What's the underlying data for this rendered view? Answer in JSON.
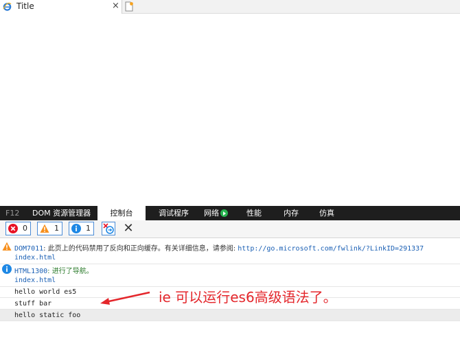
{
  "browser": {
    "tab_title": "Title",
    "close_glyph": "×"
  },
  "devtools": {
    "tabs": [
      {
        "label": "F12"
      },
      {
        "label": "DOM 资源管理器"
      },
      {
        "label": "控制台"
      },
      {
        "label": "调试程序"
      },
      {
        "label": "网络"
      },
      {
        "label": "性能"
      },
      {
        "label": "内存"
      },
      {
        "label": "仿真"
      }
    ],
    "active_tab": "控制台",
    "filters": {
      "errors": "0",
      "warnings": "1",
      "messages": "1"
    },
    "clear_glyph": "✕"
  },
  "console": {
    "warning": {
      "code": "DOM7011",
      "text": ": 此页上的代码禁用了反向和正向缓存。有关详细信息，请参阅: ",
      "url": "http://go.microsoft.com/fwlink/?LinkID=291337",
      "source": "index.html"
    },
    "info": {
      "code": "HTML1300",
      "text": ": 进行了导航。",
      "source": "index.html"
    },
    "logs": [
      "hello world es5",
      "stuff bar",
      "hello static foo"
    ]
  },
  "annotation": {
    "text": "ie 可以运行es6高级语法了。"
  },
  "colors": {
    "accent": "#4a8bd6",
    "devtools_bar": "#1e1e1e",
    "error": "#e81123",
    "warning": "#f7901e",
    "info": "#1e88e5",
    "annotation": "#e4262b"
  }
}
